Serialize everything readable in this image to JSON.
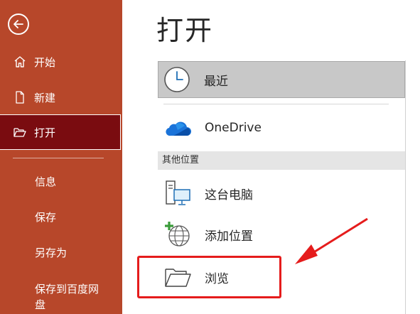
{
  "sidebar": {
    "back_icon": "arrow-left-circle-icon",
    "items": [
      {
        "label": "开始",
        "icon": "home-icon"
      },
      {
        "label": "新建",
        "icon": "new-document-icon"
      },
      {
        "label": "打开",
        "icon": "open-folder-icon"
      }
    ],
    "sub_items": [
      {
        "label": "信息"
      },
      {
        "label": "保存"
      },
      {
        "label": "另存为"
      },
      {
        "label": "保存到百度网"
      },
      {
        "label": "盘"
      }
    ],
    "colors": {
      "background": "#b7472a",
      "active": "#7a0c10"
    }
  },
  "main": {
    "title": "打开",
    "recent": {
      "label": "最近",
      "icon": "clock-icon"
    },
    "onedrive": {
      "label": "OneDrive",
      "icon": "cloud-icon"
    },
    "other_locations_header": "其他位置",
    "this_pc": {
      "label": "这台电脑",
      "icon": "computer-icon"
    },
    "add_place": {
      "label": "添加位置",
      "icon": "add-globe-icon"
    },
    "browse": {
      "label": "浏览",
      "icon": "folder-icon"
    }
  },
  "annotation": {
    "highlight_color": "#e51c1c"
  }
}
